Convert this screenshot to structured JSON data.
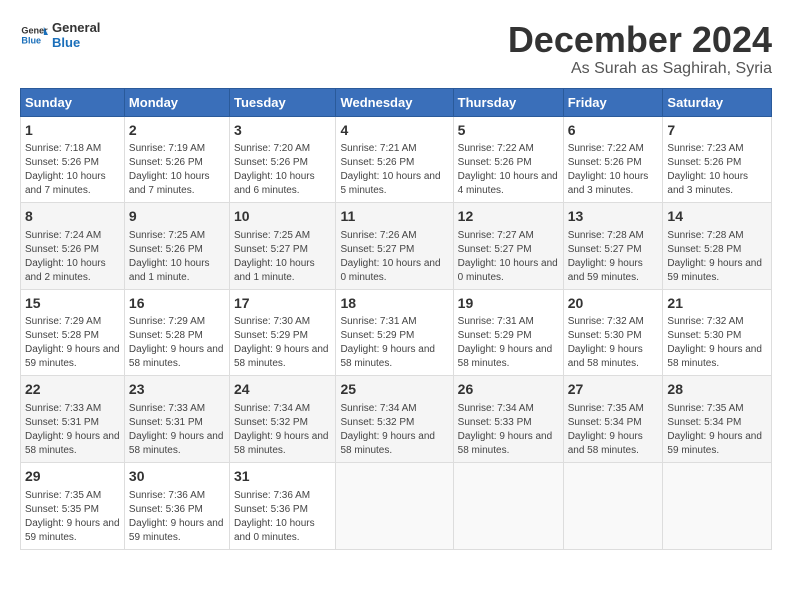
{
  "logo": {
    "text_general": "General",
    "text_blue": "Blue"
  },
  "header": {
    "month": "December 2024",
    "location": "As Surah as Saghirah, Syria"
  },
  "weekdays": [
    "Sunday",
    "Monday",
    "Tuesday",
    "Wednesday",
    "Thursday",
    "Friday",
    "Saturday"
  ],
  "weeks": [
    [
      {
        "day": "1",
        "sunrise": "Sunrise: 7:18 AM",
        "sunset": "Sunset: 5:26 PM",
        "daylight": "Daylight: 10 hours and 7 minutes."
      },
      {
        "day": "2",
        "sunrise": "Sunrise: 7:19 AM",
        "sunset": "Sunset: 5:26 PM",
        "daylight": "Daylight: 10 hours and 7 minutes."
      },
      {
        "day": "3",
        "sunrise": "Sunrise: 7:20 AM",
        "sunset": "Sunset: 5:26 PM",
        "daylight": "Daylight: 10 hours and 6 minutes."
      },
      {
        "day": "4",
        "sunrise": "Sunrise: 7:21 AM",
        "sunset": "Sunset: 5:26 PM",
        "daylight": "Daylight: 10 hours and 5 minutes."
      },
      {
        "day": "5",
        "sunrise": "Sunrise: 7:22 AM",
        "sunset": "Sunset: 5:26 PM",
        "daylight": "Daylight: 10 hours and 4 minutes."
      },
      {
        "day": "6",
        "sunrise": "Sunrise: 7:22 AM",
        "sunset": "Sunset: 5:26 PM",
        "daylight": "Daylight: 10 hours and 3 minutes."
      },
      {
        "day": "7",
        "sunrise": "Sunrise: 7:23 AM",
        "sunset": "Sunset: 5:26 PM",
        "daylight": "Daylight: 10 hours and 3 minutes."
      }
    ],
    [
      {
        "day": "8",
        "sunrise": "Sunrise: 7:24 AM",
        "sunset": "Sunset: 5:26 PM",
        "daylight": "Daylight: 10 hours and 2 minutes."
      },
      {
        "day": "9",
        "sunrise": "Sunrise: 7:25 AM",
        "sunset": "Sunset: 5:26 PM",
        "daylight": "Daylight: 10 hours and 1 minute."
      },
      {
        "day": "10",
        "sunrise": "Sunrise: 7:25 AM",
        "sunset": "Sunset: 5:27 PM",
        "daylight": "Daylight: 10 hours and 1 minute."
      },
      {
        "day": "11",
        "sunrise": "Sunrise: 7:26 AM",
        "sunset": "Sunset: 5:27 PM",
        "daylight": "Daylight: 10 hours and 0 minutes."
      },
      {
        "day": "12",
        "sunrise": "Sunrise: 7:27 AM",
        "sunset": "Sunset: 5:27 PM",
        "daylight": "Daylight: 10 hours and 0 minutes."
      },
      {
        "day": "13",
        "sunrise": "Sunrise: 7:28 AM",
        "sunset": "Sunset: 5:27 PM",
        "daylight": "Daylight: 9 hours and 59 minutes."
      },
      {
        "day": "14",
        "sunrise": "Sunrise: 7:28 AM",
        "sunset": "Sunset: 5:28 PM",
        "daylight": "Daylight: 9 hours and 59 minutes."
      }
    ],
    [
      {
        "day": "15",
        "sunrise": "Sunrise: 7:29 AM",
        "sunset": "Sunset: 5:28 PM",
        "daylight": "Daylight: 9 hours and 59 minutes."
      },
      {
        "day": "16",
        "sunrise": "Sunrise: 7:29 AM",
        "sunset": "Sunset: 5:28 PM",
        "daylight": "Daylight: 9 hours and 58 minutes."
      },
      {
        "day": "17",
        "sunrise": "Sunrise: 7:30 AM",
        "sunset": "Sunset: 5:29 PM",
        "daylight": "Daylight: 9 hours and 58 minutes."
      },
      {
        "day": "18",
        "sunrise": "Sunrise: 7:31 AM",
        "sunset": "Sunset: 5:29 PM",
        "daylight": "Daylight: 9 hours and 58 minutes."
      },
      {
        "day": "19",
        "sunrise": "Sunrise: 7:31 AM",
        "sunset": "Sunset: 5:29 PM",
        "daylight": "Daylight: 9 hours and 58 minutes."
      },
      {
        "day": "20",
        "sunrise": "Sunrise: 7:32 AM",
        "sunset": "Sunset: 5:30 PM",
        "daylight": "Daylight: 9 hours and 58 minutes."
      },
      {
        "day": "21",
        "sunrise": "Sunrise: 7:32 AM",
        "sunset": "Sunset: 5:30 PM",
        "daylight": "Daylight: 9 hours and 58 minutes."
      }
    ],
    [
      {
        "day": "22",
        "sunrise": "Sunrise: 7:33 AM",
        "sunset": "Sunset: 5:31 PM",
        "daylight": "Daylight: 9 hours and 58 minutes."
      },
      {
        "day": "23",
        "sunrise": "Sunrise: 7:33 AM",
        "sunset": "Sunset: 5:31 PM",
        "daylight": "Daylight: 9 hours and 58 minutes."
      },
      {
        "day": "24",
        "sunrise": "Sunrise: 7:34 AM",
        "sunset": "Sunset: 5:32 PM",
        "daylight": "Daylight: 9 hours and 58 minutes."
      },
      {
        "day": "25",
        "sunrise": "Sunrise: 7:34 AM",
        "sunset": "Sunset: 5:32 PM",
        "daylight": "Daylight: 9 hours and 58 minutes."
      },
      {
        "day": "26",
        "sunrise": "Sunrise: 7:34 AM",
        "sunset": "Sunset: 5:33 PM",
        "daylight": "Daylight: 9 hours and 58 minutes."
      },
      {
        "day": "27",
        "sunrise": "Sunrise: 7:35 AM",
        "sunset": "Sunset: 5:34 PM",
        "daylight": "Daylight: 9 hours and 58 minutes."
      },
      {
        "day": "28",
        "sunrise": "Sunrise: 7:35 AM",
        "sunset": "Sunset: 5:34 PM",
        "daylight": "Daylight: 9 hours and 59 minutes."
      }
    ],
    [
      {
        "day": "29",
        "sunrise": "Sunrise: 7:35 AM",
        "sunset": "Sunset: 5:35 PM",
        "daylight": "Daylight: 9 hours and 59 minutes."
      },
      {
        "day": "30",
        "sunrise": "Sunrise: 7:36 AM",
        "sunset": "Sunset: 5:36 PM",
        "daylight": "Daylight: 9 hours and 59 minutes."
      },
      {
        "day": "31",
        "sunrise": "Sunrise: 7:36 AM",
        "sunset": "Sunset: 5:36 PM",
        "daylight": "Daylight: 10 hours and 0 minutes."
      },
      null,
      null,
      null,
      null
    ]
  ]
}
